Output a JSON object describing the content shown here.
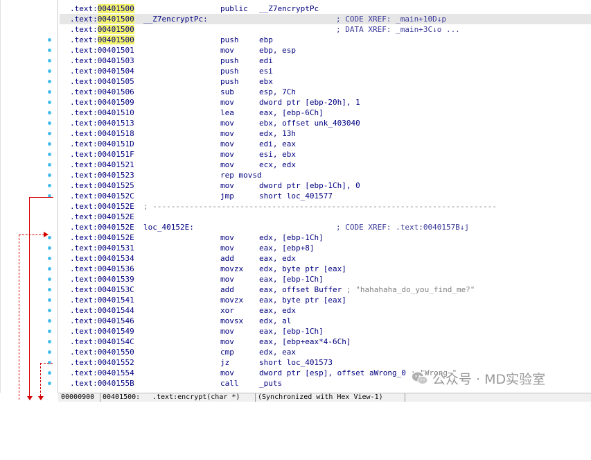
{
  "colors": {
    "address": "#000080",
    "highlight": "#f3f36a",
    "comment": "#808080",
    "arrow": "#d40000",
    "dot": "#44bdee"
  },
  "rows": [
    {
      "seg": ".text:",
      "addr": "00401500",
      "hladdr": true,
      "label": "",
      "mn": "public",
      "op": "__Z7encryptPc",
      "cmt": ""
    },
    {
      "seg": ".text:",
      "addr": "00401500",
      "hladdr": true,
      "label": "__Z7encryptPc:",
      "mn": "",
      "op": "",
      "cmt": "; CODE XREF: _main+10D↓p",
      "hl": true
    },
    {
      "seg": ".text:",
      "addr": "00401500",
      "hladdr": true,
      "label": "",
      "mn": "",
      "op": "",
      "cmt": "; DATA XREF: _main+3C↓o ..."
    },
    {
      "seg": ".text:",
      "addr": "00401500",
      "hladdr": true,
      "label": "",
      "mn": "push",
      "op": "ebp",
      "cmt": ""
    },
    {
      "seg": ".text:",
      "addr": "00401501",
      "label": "",
      "mn": "mov",
      "op": "ebp, esp",
      "cmt": ""
    },
    {
      "seg": ".text:",
      "addr": "00401503",
      "label": "",
      "mn": "push",
      "op": "edi",
      "cmt": ""
    },
    {
      "seg": ".text:",
      "addr": "00401504",
      "label": "",
      "mn": "push",
      "op": "esi",
      "cmt": ""
    },
    {
      "seg": ".text:",
      "addr": "00401505",
      "label": "",
      "mn": "push",
      "op": "ebx",
      "cmt": ""
    },
    {
      "seg": ".text:",
      "addr": "00401506",
      "label": "",
      "mn": "sub",
      "op": "esp, 7Ch",
      "cmt": ""
    },
    {
      "seg": ".text:",
      "addr": "00401509",
      "label": "",
      "mn": "mov",
      "op": "dword ptr [ebp-20h], 1",
      "cmt": ""
    },
    {
      "seg": ".text:",
      "addr": "00401510",
      "label": "",
      "mn": "lea",
      "op": "eax, [ebp-6Ch]",
      "cmt": ""
    },
    {
      "seg": ".text:",
      "addr": "00401513",
      "label": "",
      "mn": "mov",
      "op": "ebx, offset unk_403040",
      "cmt": ""
    },
    {
      "seg": ".text:",
      "addr": "00401518",
      "label": "",
      "mn": "mov",
      "op": "edx, 13h",
      "cmt": ""
    },
    {
      "seg": ".text:",
      "addr": "0040151D",
      "label": "",
      "mn": "mov",
      "op": "edi, eax",
      "cmt": ""
    },
    {
      "seg": ".text:",
      "addr": "0040151F",
      "label": "",
      "mn": "mov",
      "op": "esi, ebx",
      "cmt": ""
    },
    {
      "seg": ".text:",
      "addr": "00401521",
      "label": "",
      "mn": "mov",
      "op": "ecx, edx",
      "cmt": ""
    },
    {
      "seg": ".text:",
      "addr": "00401523",
      "label": "",
      "mn": "rep movsd",
      "op": "",
      "cmt": ""
    },
    {
      "seg": ".text:",
      "addr": "00401525",
      "label": "",
      "mn": "mov",
      "op": "dword ptr [ebp-1Ch], 0",
      "cmt": ""
    },
    {
      "seg": ".text:",
      "addr": "0040152C",
      "label": "",
      "mn": "jmp",
      "op": "short loc_401577",
      "cmt": ""
    },
    {
      "seg": ".text:",
      "addr": "0040152E",
      "label": "; ---------------------------------------------------------------------------",
      "sep": true,
      "mn": "",
      "op": "",
      "cmt": ""
    },
    {
      "seg": ".text:",
      "addr": "0040152E",
      "label": "",
      "mn": "",
      "op": "",
      "cmt": ""
    },
    {
      "seg": ".text:",
      "addr": "0040152E",
      "label": "loc_40152E:",
      "mn": "",
      "op": "",
      "cmt": "; CODE XREF: .text:0040157B↓j"
    },
    {
      "seg": ".text:",
      "addr": "0040152E",
      "label": "",
      "mn": "mov",
      "op": "edx, [ebp-1Ch]",
      "cmt": ""
    },
    {
      "seg": ".text:",
      "addr": "00401531",
      "label": "",
      "mn": "mov",
      "op": "eax, [ebp+8]",
      "cmt": ""
    },
    {
      "seg": ".text:",
      "addr": "00401534",
      "label": "",
      "mn": "add",
      "op": "eax, edx",
      "cmt": ""
    },
    {
      "seg": ".text:",
      "addr": "00401536",
      "label": "",
      "mn": "movzx",
      "op": "edx, byte ptr [eax]",
      "cmt": ""
    },
    {
      "seg": ".text:",
      "addr": "00401539",
      "label": "",
      "mn": "mov",
      "op": "eax, [ebp-1Ch]",
      "cmt": ""
    },
    {
      "seg": ".text:",
      "addr": "0040153C",
      "label": "",
      "mn": "add",
      "op": "eax, offset Buffer",
      "cmt": "; \"hahahaha_do_you_find_me?\"",
      "cmtInline": true
    },
    {
      "seg": ".text:",
      "addr": "00401541",
      "label": "",
      "mn": "movzx",
      "op": "eax, byte ptr [eax]",
      "cmt": ""
    },
    {
      "seg": ".text:",
      "addr": "00401544",
      "label": "",
      "mn": "xor",
      "op": "eax, edx",
      "cmt": ""
    },
    {
      "seg": ".text:",
      "addr": "00401546",
      "label": "",
      "mn": "movsx",
      "op": "edx, al",
      "cmt": ""
    },
    {
      "seg": ".text:",
      "addr": "00401549",
      "label": "",
      "mn": "mov",
      "op": "eax, [ebp-1Ch]",
      "cmt": ""
    },
    {
      "seg": ".text:",
      "addr": "0040154C",
      "label": "",
      "mn": "mov",
      "op": "eax, [ebp+eax*4-6Ch]",
      "cmt": ""
    },
    {
      "seg": ".text:",
      "addr": "00401550",
      "label": "",
      "mn": "cmp",
      "op": "edx, eax",
      "cmt": ""
    },
    {
      "seg": ".text:",
      "addr": "00401552",
      "label": "",
      "mn": "jz",
      "op": "short loc_401573",
      "cmt": ""
    },
    {
      "seg": ".text:",
      "addr": "00401554",
      "label": "",
      "mn": "mov",
      "op": "dword ptr [esp], offset aWrong_0",
      "cmt": "; \"Wrong~\"",
      "cmtInline": true
    },
    {
      "seg": ".text:",
      "addr": "0040155B",
      "label": "",
      "mn": "call",
      "op": "_puts",
      "cmt": ""
    }
  ],
  "status": {
    "offset": "00000900",
    "address": "00401500:",
    "location": ".text:encrypt(char *)",
    "sync": "(Synchronized with Hex View-1)"
  },
  "watermark": {
    "text": "公众号 · MD实验室"
  }
}
